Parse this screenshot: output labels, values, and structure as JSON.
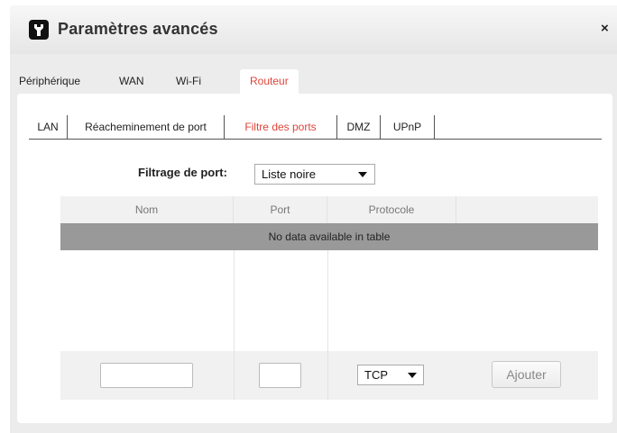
{
  "dialog": {
    "title": "Paramètres avancés",
    "icon": "wrench-icon",
    "close_label": "×"
  },
  "main_tabs": [
    {
      "label": "Périphérique",
      "active": false
    },
    {
      "label": "WAN",
      "active": false
    },
    {
      "label": "Wi-Fi",
      "active": false
    },
    {
      "label": "Routeur",
      "active": true
    }
  ],
  "sub_tabs": [
    {
      "label": "LAN",
      "active": false
    },
    {
      "label": "Réacheminement de port",
      "active": false
    },
    {
      "label": "Filtre des ports",
      "active": true
    },
    {
      "label": "DMZ",
      "active": false
    },
    {
      "label": "UPnP",
      "active": false
    }
  ],
  "filter": {
    "label": "Filtrage de port:",
    "selected": "Liste noire"
  },
  "table": {
    "columns": [
      "Nom",
      "Port",
      "Protocole",
      ""
    ],
    "empty_message": "No data available in table"
  },
  "add_row": {
    "name_value": "",
    "port_value": "",
    "protocol_selected": "TCP",
    "add_button_label": "Ajouter"
  },
  "colors": {
    "accent": "#e0443a",
    "empty_row": "#999999",
    "dialog_bg": "#ececec"
  }
}
